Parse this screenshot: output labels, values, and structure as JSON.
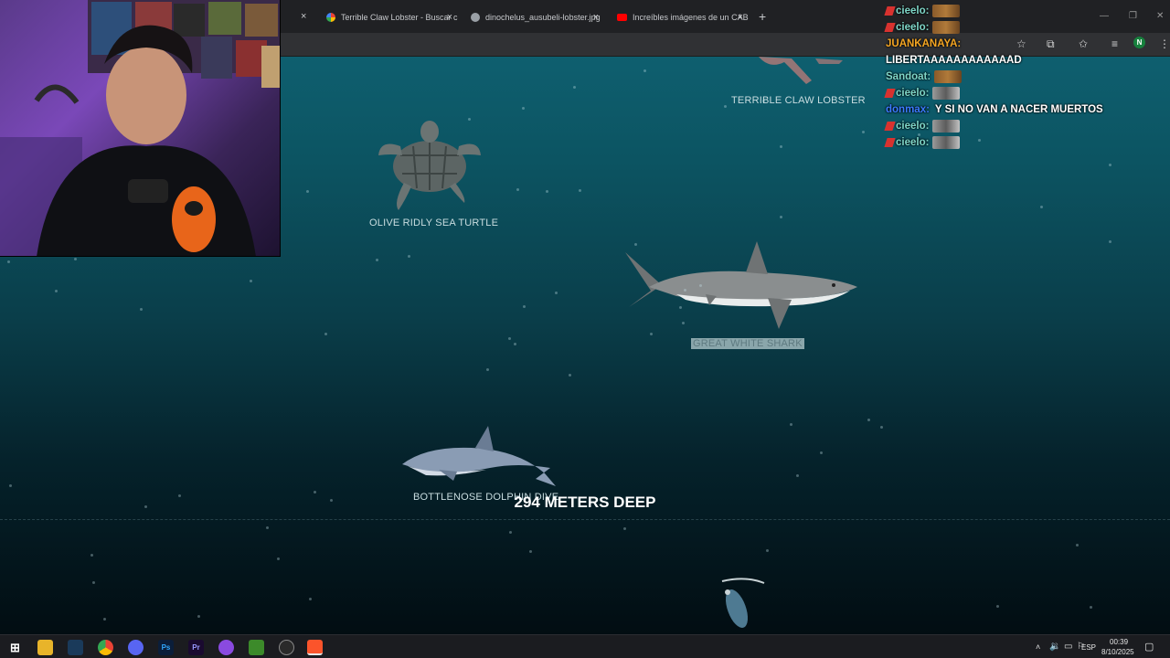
{
  "browser": {
    "tabs": [
      {
        "title": "Terrible Claw Lobster - Buscar c",
        "icon": "google-icon"
      },
      {
        "title": "dinochelus_ausubeli-lobster.jpg",
        "icon": "globe-icon"
      },
      {
        "title": "Increíbles imágenes de un CAB",
        "icon": "youtube-icon"
      }
    ],
    "new_tab": "+",
    "close": "×",
    "profile_initial": "N"
  },
  "scene": {
    "creatures": [
      {
        "name": "TERRIBLE CLAW LOBSTER"
      },
      {
        "name": "OLIVE RIDLY SEA TURTLE"
      },
      {
        "name": "GREAT WHITE SHARK"
      },
      {
        "name": "BOTTLENOSE DOLPHIN DIVE"
      }
    ],
    "depth_text": "294 METERS DEEP"
  },
  "chat": {
    "messages": [
      {
        "user": "cieelo:",
        "text": "",
        "user_color": "#7fd6c8",
        "badge": true,
        "emote": "brown"
      },
      {
        "user": "cieelo:",
        "text": "",
        "user_color": "#7fd6c8",
        "badge": true,
        "emote": "brown"
      },
      {
        "user": "JUANKANAYA:",
        "text": "",
        "user_color": "#f5a623",
        "badge": false,
        "emote": ""
      },
      {
        "user": "",
        "text": "LIBERTAAAAAAAAAAAAD",
        "user_color": "#ffffff",
        "badge": false,
        "emote": ""
      },
      {
        "user": "Sandoat:",
        "text": "",
        "user_color": "#7fd6c8",
        "badge": false,
        "emote": "brown"
      },
      {
        "user": "cieelo:",
        "text": "",
        "user_color": "#7fd6c8",
        "badge": true,
        "emote": "grey"
      },
      {
        "user": "donmax:",
        "text": "Y SI NO VAN A NACER MUERTOS",
        "user_color": "#3b7bff",
        "badge": false,
        "emote": ""
      },
      {
        "user": "cieelo:",
        "text": "",
        "user_color": "#7fd6c8",
        "badge": true,
        "emote": "grey"
      },
      {
        "user": "cieelo:",
        "text": "",
        "user_color": "#7fd6c8",
        "badge": true,
        "emote": "grey"
      }
    ]
  },
  "taskbar": {
    "apps": [
      "windows-start-icon",
      "file-explorer-icon",
      "steam-icon",
      "chrome-icon",
      "discord-icon",
      "photoshop-icon",
      "premiere-icon",
      "podcast-icon",
      "minecraft-icon",
      "obs-icon",
      "brave-icon"
    ],
    "ps_label": "Ps",
    "pr_label": "Pr",
    "language": "ESP",
    "time": "00:39",
    "date": "8/10/2025"
  }
}
